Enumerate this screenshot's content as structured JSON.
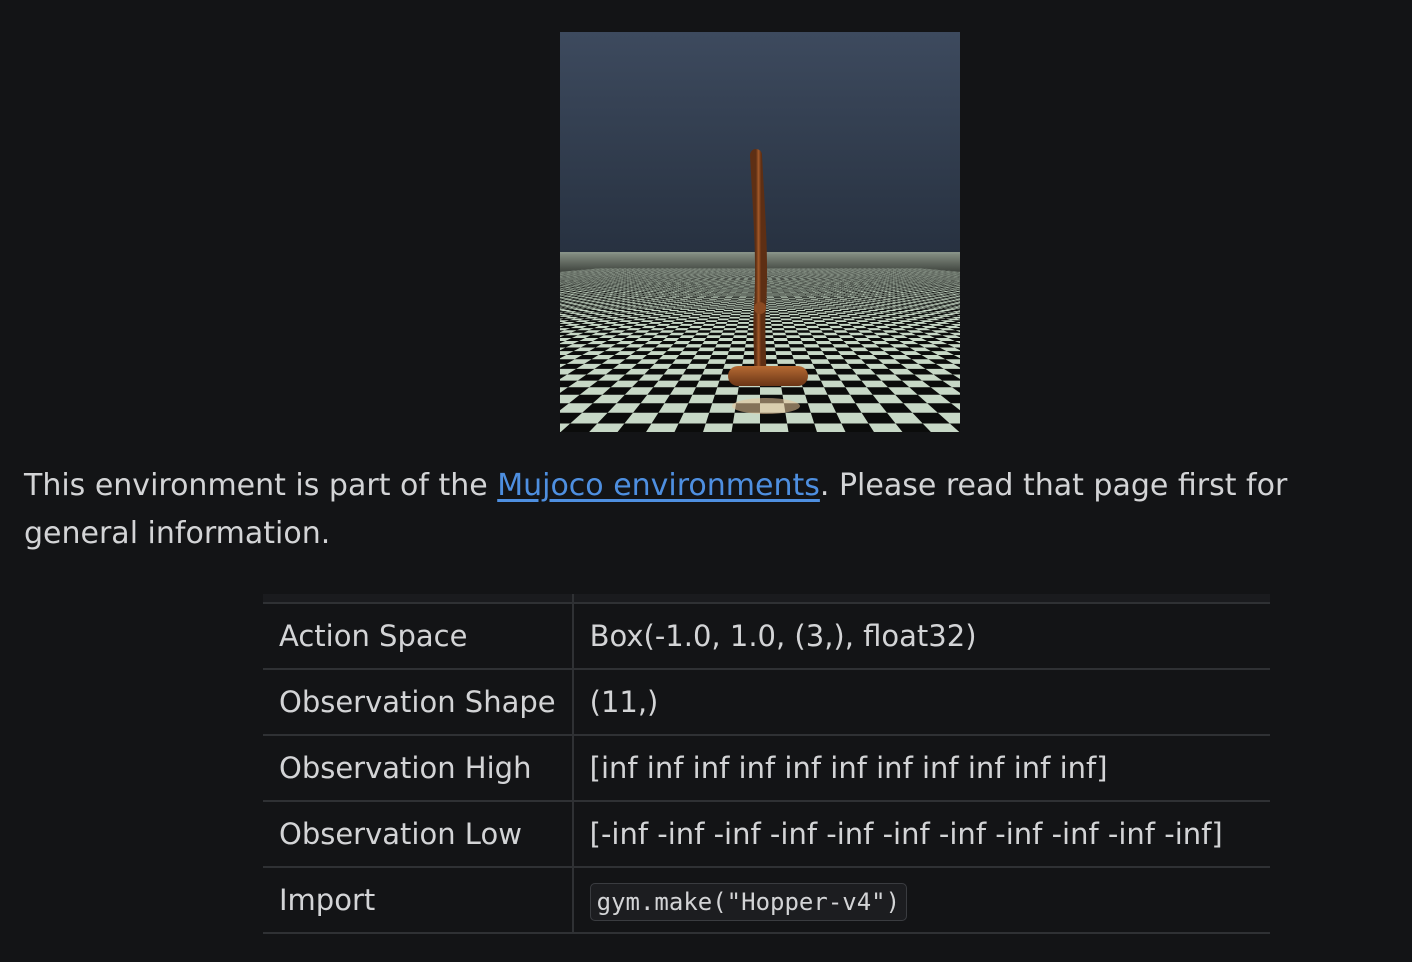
{
  "figure": {
    "alt": "Hopper",
    "sky_color_top": "#3d4a5e",
    "sky_color_bottom": "#273140",
    "checker_light": "#c7d8c6",
    "checker_dark": "#0b0c0b",
    "hopper_color": "#8a4a22"
  },
  "intro": {
    "before_link": "This environment is part of the ",
    "link_text": "Mujoco environments",
    "after_link": ". Please read that page first for general information."
  },
  "spec_table": {
    "rows": [
      {
        "key": "Action Space",
        "value": "Box(-1.0, 1.0, (3,), float32)"
      },
      {
        "key": "Observation Shape",
        "value": "(11,)"
      },
      {
        "key": "Observation High",
        "value": "[inf inf inf inf inf inf inf inf inf inf inf]"
      },
      {
        "key": "Observation Low",
        "value": "[-inf -inf -inf -inf -inf -inf -inf -inf -inf -inf -inf]"
      },
      {
        "key": "Import",
        "value": "gym.make(\"Hopper-v4\")"
      }
    ]
  },
  "colors": {
    "background": "#131416",
    "text": "#d3d4d6",
    "link": "#4e8fe0",
    "border": "#2f3134"
  }
}
